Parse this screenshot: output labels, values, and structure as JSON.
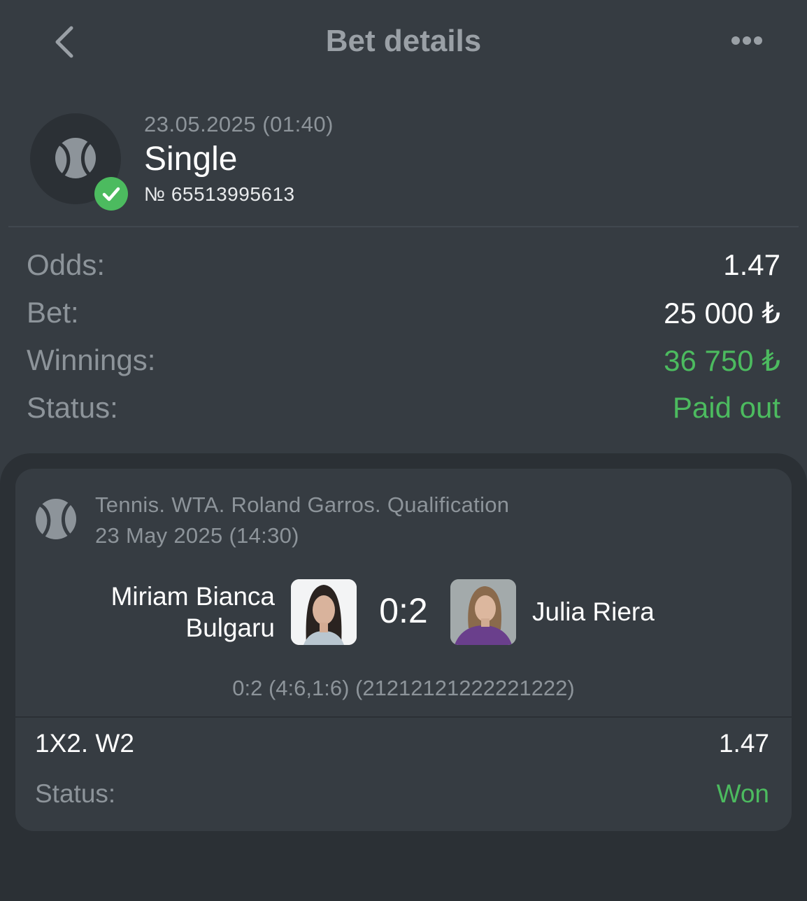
{
  "header": {
    "title": "Bet details",
    "back_icon": "chevron-left-icon",
    "more_icon": "more-horizontal-icon"
  },
  "bet": {
    "date": "23.05.2025 (01:40)",
    "type": "Single",
    "number": "№ 65513995613",
    "sport_icon": "tennis-ball-icon",
    "status_icon": "check-circle-icon"
  },
  "summary": {
    "odds_label": "Odds:",
    "odds_value": "1.47",
    "bet_label": "Bet:",
    "bet_value": "25 000 ₺",
    "winnings_label": "Winnings:",
    "winnings_value": "36 750 ₺",
    "status_label": "Status:",
    "status_value": "Paid out"
  },
  "event": {
    "league": "Tennis. WTA. Roland Garros. Qualification",
    "date": "23 May 2025 (14:30)",
    "team1_line1": "Miriam Bianca",
    "team1_line2": "Bulgaru",
    "score": "0:2",
    "team2": "Julia Riera",
    "set_scores": "0:2 (4:6,1:6) (21212121222221222)"
  },
  "selection": {
    "market": "1X2. W2",
    "odds": "1.47",
    "status_label": "Status:",
    "status_value": "Won"
  },
  "colors": {
    "background": "#363c42",
    "panel": "#2b3035",
    "accent_green": "#4cbb5f",
    "muted_text": "#8d949a"
  }
}
